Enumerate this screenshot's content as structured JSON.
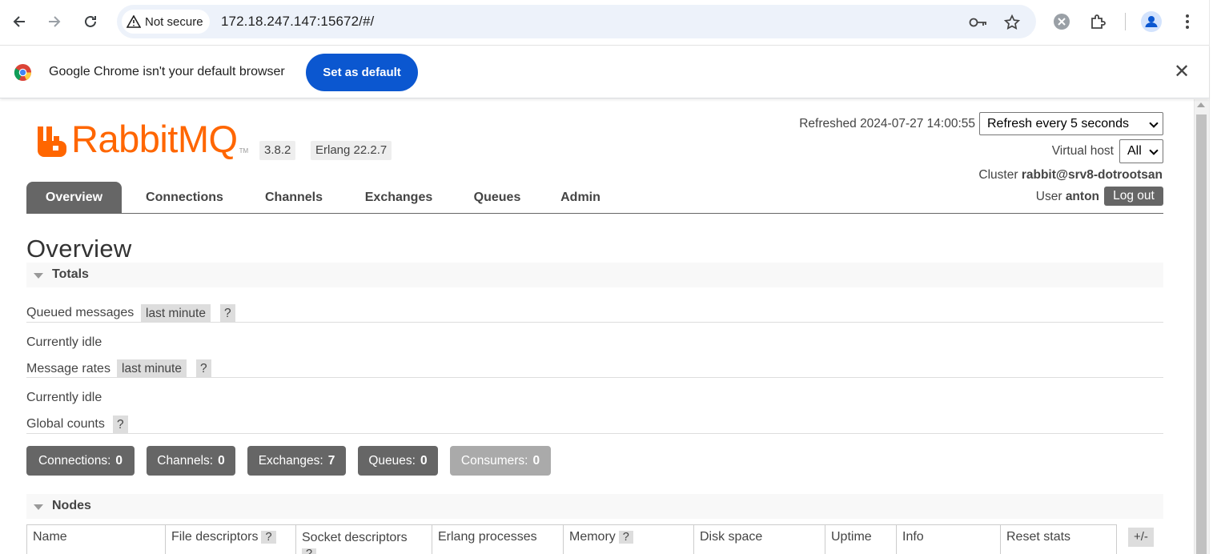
{
  "browser": {
    "security_label": "Not secure",
    "url": "172.18.247.147:15672/#/",
    "infobar_message": "Google Chrome isn't your default browser",
    "set_default_label": "Set as default"
  },
  "app": {
    "logo_text": "RabbitMQ",
    "logo_tm": "TM",
    "version": "3.8.2",
    "erlang": "Erlang 22.2.7",
    "refreshed_label": "Refreshed",
    "refreshed_time": "2024-07-27 14:00:55",
    "refresh_select": "Refresh every 5 seconds",
    "vhost_label": "Virtual host",
    "vhost_select": "All",
    "cluster_label": "Cluster",
    "cluster_name": "rabbit@srv8-dotrootsan",
    "user_label": "User",
    "user_name": "anton",
    "logout_label": "Log out",
    "brand_color": "#ff6600"
  },
  "tabs": [
    "Overview",
    "Connections",
    "Channels",
    "Exchanges",
    "Queues",
    "Admin"
  ],
  "page_title": "Overview",
  "totals": {
    "header": "Totals",
    "queued_label": "Queued messages",
    "queued_range": "last minute",
    "help": "?",
    "queued_idle": "Currently idle",
    "rates_label": "Message rates",
    "rates_range": "last minute",
    "rates_idle": "Currently idle",
    "global_label": "Global counts"
  },
  "counts": [
    {
      "label": "Connections:",
      "value": "0"
    },
    {
      "label": "Channels:",
      "value": "0"
    },
    {
      "label": "Exchanges:",
      "value": "7"
    },
    {
      "label": "Queues:",
      "value": "0"
    },
    {
      "label": "Consumers:",
      "value": "0"
    }
  ],
  "nodes": {
    "header": "Nodes",
    "columns": [
      "Name",
      "File descriptors",
      "Socket descriptors",
      "Erlang processes",
      "Memory",
      "Disk space",
      "Uptime",
      "Info",
      "Reset stats"
    ],
    "help": "?",
    "toggle": "+/-"
  }
}
